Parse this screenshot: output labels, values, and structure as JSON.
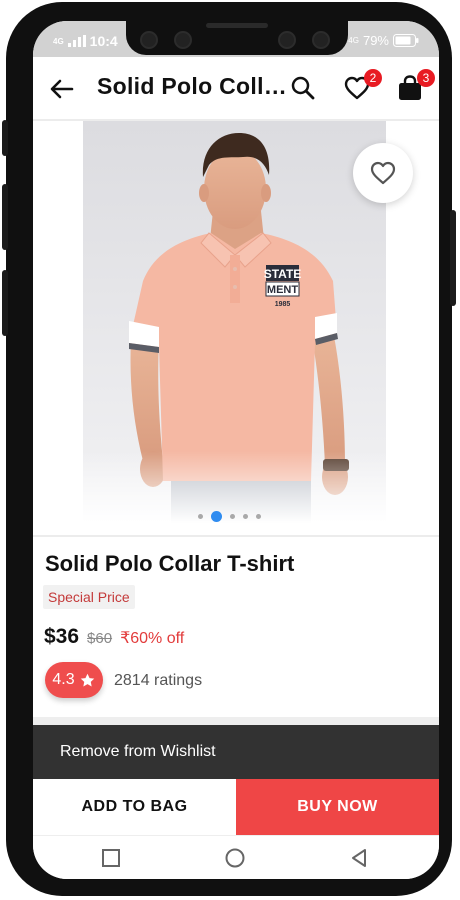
{
  "status_bar": {
    "network_left": "4G",
    "time": "10:4",
    "network_right": "4G",
    "battery": "79%"
  },
  "app_bar": {
    "title": "Solid Polo Collar T-shirt",
    "back_icon": "arrow-left-icon",
    "search_icon": "search-icon",
    "wishlist_icon": "heart-icon",
    "wishlist_count": "2",
    "bag_icon": "shopping-bag-icon",
    "bag_count": "3"
  },
  "product": {
    "image_alt": "Model wearing pink polo shirt",
    "shirt_print_line1": "STATE",
    "shirt_print_line2": "MENT",
    "shirt_print_line3": "1985",
    "carousel_total": 5,
    "carousel_active_index": 1,
    "name": "Solid Polo Collar T-shirt",
    "special_label": "Special Price",
    "price": "$36",
    "mrp": "$60",
    "discount": "₹60% off",
    "rating": "4.3",
    "ratings_count": "2814 ratings"
  },
  "snackbar": {
    "message": "Remove from Wishlist"
  },
  "actions": {
    "add_to_bag": "ADD TO BAG",
    "buy_now": "BUY NOW"
  },
  "colors": {
    "accent": "#ef4646",
    "badge": "#e81b23",
    "active_dot": "#2f8cf0"
  }
}
